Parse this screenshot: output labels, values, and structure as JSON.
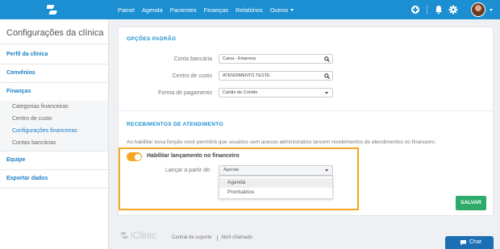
{
  "topbar": {
    "nav": [
      "Painel",
      "Agenda",
      "Pacientes",
      "Finanças",
      "Relatórios",
      "Outros"
    ],
    "icons": [
      "logo-icon",
      "plus-icon",
      "bell-icon",
      "gear-icon",
      "avatar"
    ]
  },
  "sidebar": {
    "title": "Configurações da clínica",
    "links": {
      "perfil": "Perfil da clínica",
      "convenios": "Convênios",
      "financas": "Finanças",
      "equipe": "Equipe",
      "exportar": "Exportar dados"
    },
    "sub_items": [
      "Categorias financeiras",
      "Centro de custo",
      "Configurações financeiras",
      "Contas bancárias"
    ],
    "active_sub": "Configurações financeiras"
  },
  "opcoes": {
    "heading": "OPÇÕES PADRÃO",
    "conta_label": "Conta bancária",
    "conta_value": "Caixa - Empresa",
    "centro_label": "Centro de custo",
    "centro_value": "ATENDIMENTO TESTE",
    "forma_label": "Forma de pagamento",
    "forma_value": "Cartão de Crédito"
  },
  "recebimentos": {
    "heading": "RECEBIMENTOS DE ATENDIMENTO",
    "description": "Ao habilitar essa função você permitirá que usuários sem acesso administrativo lancem recebimentos de atendimentos no financeiro.",
    "toggle_label": "Habilitar lançamento no financeiro",
    "toggle_on": true,
    "lancar_label": "Lançar a partir de:",
    "lancar_value": "Agenda",
    "options": [
      "Agenda",
      "Prontuários"
    ]
  },
  "save_label": "SALVAR",
  "footer": {
    "brand": "iClinic",
    "suporte": "Central de suporte",
    "chamado": "Abrir chamado"
  },
  "chat_label": "Chat",
  "colors": {
    "primary": "#1b8fd1",
    "accent": "#f5a623",
    "save": "#2eab6a",
    "chat": "#1b6fb5"
  }
}
